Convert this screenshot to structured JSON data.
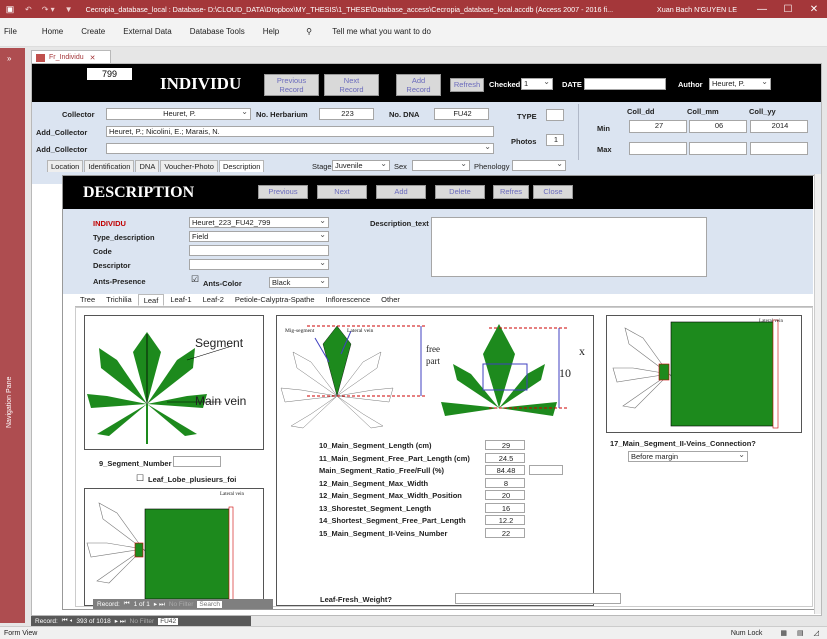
{
  "titlebar": {
    "title": "Cecropia_database_local : Database- D:\\CLOUD_DATA\\Dropbox\\MY_THESIS\\1_THESE\\Database_access\\Cecropia_database_local.accdb (Access 2007 - 2016 fi...",
    "user": "Xuan Bach N'GUYEN LE"
  },
  "ribbon": {
    "tabs": [
      "File",
      "Home",
      "Create",
      "External Data",
      "Database Tools",
      "Help"
    ],
    "tell_me": "Tell me what you want to do"
  },
  "navpane": {
    "label": "Navigation Pane"
  },
  "doc_tab": {
    "label": "Fr_Individu"
  },
  "form": {
    "record_number": "799",
    "title": "INDIVIDU",
    "buttons": {
      "previous": [
        "Previous",
        "Record"
      ],
      "next": [
        "Next",
        "Record"
      ],
      "add": [
        "Add",
        "Record"
      ],
      "refresh": "Refresh"
    },
    "checked_label": "Checked",
    "checked_value": "1",
    "date_label": "DATE",
    "date_value": "",
    "author_label": "Author",
    "author_value": "Heuret, P.",
    "collector_label": "Collector",
    "collector_value": "Heuret, P.",
    "herbarium_label": "No. Herbarium",
    "herbarium_value": "223",
    "dna_label": "No. DNA",
    "dna_value": "FU42",
    "type_label": "TYPE",
    "type_value": "",
    "add_collector_label": "Add_Collector",
    "add_collector_value": "Heuret, P.; Nicolini, E.; Marais, N.",
    "add_collector2_label": "Add_Collector",
    "add_collector2_value": "",
    "photos_label": "Photos",
    "photos_value": "1",
    "coll": {
      "dd": "Coll_dd",
      "mm": "Coll_mm",
      "yy": "Coll_yy",
      "min": "Min",
      "max": "Max",
      "min_dd": "27",
      "min_mm": "06",
      "min_yy": "2014"
    },
    "subtabs": [
      "Location",
      "Identification",
      "DNA",
      "Voucher-Photo",
      "Description"
    ],
    "stage_label": "Stage",
    "stage_value": "Juvenile",
    "sex_label": "Sex",
    "sex_value": "",
    "phenology_label": "Phenology",
    "phenology_value": ""
  },
  "description": {
    "title": "DESCRIPTION",
    "buttons": [
      "Previous",
      "Next",
      "Add",
      "Delete",
      "Refres",
      "Close"
    ],
    "individu_label": "INDIVIDU",
    "individu_value": "Heuret_223_FU42_799",
    "type_label": "Type_description",
    "type_value": "Field",
    "code_label": "Code",
    "code_value": "",
    "descriptor_label": "Descriptor",
    "descriptor_value": "",
    "ants_presence_label": "Ants-Presence",
    "ants_color_label": "Ants-Color",
    "ants_color_value": "Black",
    "desc_text_label": "Description_text",
    "tabs": [
      "Tree",
      "Trichilia",
      "Leaf",
      "Leaf-1",
      "Leaf-2",
      "Petiole-Calyptra-Spathe",
      "Inflorescence",
      "Other"
    ]
  },
  "leaf": {
    "img1": {
      "segment": "Segment",
      "main_vein": "Main vein"
    },
    "seg_number_label": "9_Segment_Number",
    "seg_number_value": "",
    "lobe_label": "Leaf_Lobe_plusieurs_foi",
    "img2": {
      "mig": "Mig-segment",
      "lateral": "Lateral vein",
      "free": "free",
      "part": "part",
      "x": "x",
      "ten": "10"
    },
    "lateral_vein": "Lateral vein",
    "measures": [
      {
        "label": "10_Main_Segment_Length (cm)",
        "value": "29"
      },
      {
        "label": "11_Main_Segment_Free_Part_Length (cm)",
        "value": "24.5"
      },
      {
        "label": "Main_Segment_Ratio_Free/Full (%)",
        "value": "84.48"
      },
      {
        "label": "12_Main_Segment_Max_Width",
        "value": "8"
      },
      {
        "label": "12_Main_Segment_Max_Width_Position",
        "value": "20"
      },
      {
        "label": "13_Shorestet_Segment_Length",
        "value": "16"
      },
      {
        "label": "14_Shortest_Segment_Free_Part_Length",
        "value": "12.2"
      },
      {
        "label": "15_Main_Segment_II-Veins_Number",
        "value": "22"
      }
    ],
    "conn_label": "17_Main_Segment_II-Veins_Connection?",
    "conn_value": "Before margin",
    "fresh_weight_label": "Leaf-Fresh_Weight?"
  },
  "inner_record": {
    "label": "Record:",
    "position": "1 of 1",
    "filter": "No Filter",
    "search": "Search"
  },
  "outer_record": {
    "label": "Record:",
    "position": "393 of 1018",
    "filter": "No Filter",
    "search": "FU42"
  },
  "status": {
    "left": "Form View",
    "numlock": "Num Lock"
  }
}
